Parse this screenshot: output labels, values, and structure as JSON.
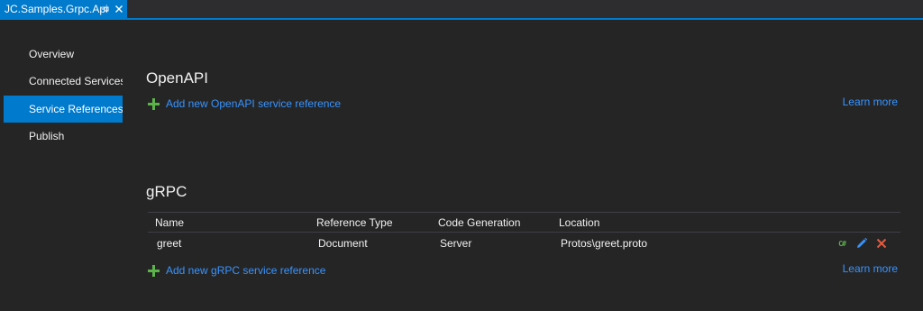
{
  "tab": {
    "title": "JC.Samples.Grpc.Api"
  },
  "sidebar": {
    "items": [
      {
        "label": "Overview",
        "active": false
      },
      {
        "label": "Connected Services",
        "active": false
      },
      {
        "label": "Service References",
        "active": true
      },
      {
        "label": "Publish",
        "active": false
      }
    ]
  },
  "openapi": {
    "title": "OpenAPI",
    "add_label": "Add new OpenAPI service reference",
    "learn_more": "Learn more"
  },
  "grpc": {
    "title": "gRPC",
    "columns": [
      "Name",
      "Reference Type",
      "Code Generation",
      "Location"
    ],
    "rows": [
      {
        "name": "greet",
        "reference_type": "Document",
        "code_generation": "Server",
        "location": "Protos\\greet.proto"
      }
    ],
    "row_actions": {
      "code_glyph": "C#"
    },
    "add_label": "Add new gRPC service reference",
    "learn_more": "Learn more"
  },
  "colors": {
    "accent": "#007acc",
    "link": "#3794ff",
    "add_icon": "#5bb34a",
    "delete_icon": "#e8593a",
    "background": "#252526"
  }
}
